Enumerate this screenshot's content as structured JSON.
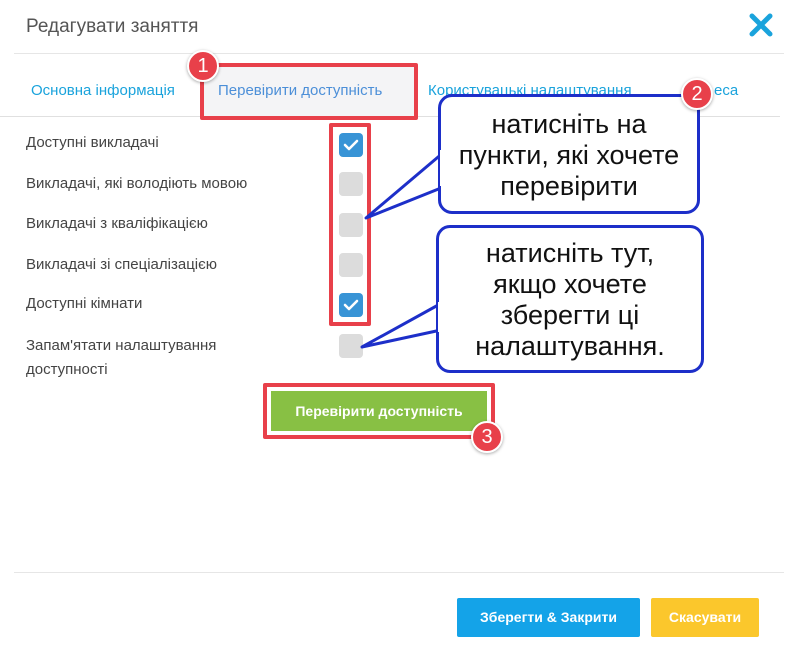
{
  "dialog": {
    "title": "Редагувати заняття"
  },
  "tabs": [
    {
      "label": "Основна інформація"
    },
    {
      "label": "Перевірити доступність"
    },
    {
      "label": "Користувацькі налаштування"
    },
    {
      "label": "еса"
    }
  ],
  "options": [
    {
      "label": "Доступні викладачі",
      "checked": true
    },
    {
      "label": "Викладачі, які володіють мовою",
      "checked": false
    },
    {
      "label": "Викладачі з кваліфікацією",
      "checked": false
    },
    {
      "label": "Викладачі зі спеціалізацією",
      "checked": false
    },
    {
      "label": "Доступні кімнати",
      "checked": true
    },
    {
      "label_line1": "Запам'ятати налаштування",
      "label_line2": "доступності",
      "checked": false
    }
  ],
  "buttons": {
    "check_availability": "Перевірити доступність",
    "save_close": "Зберегти & Закрити",
    "cancel": "Скасувати"
  },
  "annotations": {
    "badge_1": "1",
    "badge_2": "2",
    "badge_3": "3",
    "callout_top": [
      "натисніть на",
      "пункти, які хочете",
      "перевірити"
    ],
    "callout_bottom": [
      "натисніть тут,",
      "якщо хочете",
      "зберегти ці",
      "налаштування."
    ]
  },
  "colors": {
    "accent_blue": "#1aa3dc",
    "checkbox_checked": "#3894d6",
    "check_button_green": "#88c044",
    "save_button_blue": "#14a3e8",
    "cancel_button_yellow": "#fbc72c",
    "highlight_red": "#e8404a",
    "callout_border": "#1d2fc9"
  },
  "icons": {
    "close": "close-x-icon",
    "check": "checkmark-icon"
  }
}
